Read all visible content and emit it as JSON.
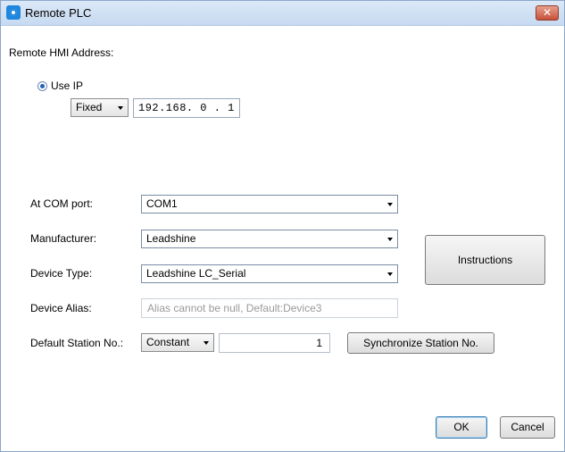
{
  "window": {
    "title": "Remote PLC",
    "close_glyph": "✕"
  },
  "remote_hmi": {
    "heading": "Remote HMI Address:",
    "use_ip_label": "Use IP",
    "ip_mode": "Fixed",
    "ip_address": "192.168. 0 . 1"
  },
  "com_port": {
    "label": "At COM port:",
    "value": "COM1"
  },
  "manufacturer": {
    "label": "Manufacturer:",
    "value": "Leadshine"
  },
  "device_type": {
    "label": "Device Type:",
    "value": "Leadshine LC_Serial"
  },
  "device_alias": {
    "label": "Device Alias:",
    "placeholder": "Alias cannot be null, Default:Device3"
  },
  "station": {
    "label": "Default Station No.:",
    "mode": "Constant",
    "value": "1",
    "sync_button": "Synchronize Station No."
  },
  "instructions_button": "Instructions",
  "footer": {
    "ok": "OK",
    "cancel": "Cancel"
  },
  "icons": {
    "app": "app-icon",
    "close": "close-icon",
    "dropdown": "chevron-down-icon",
    "radio": "radio-selected-icon"
  },
  "colors": {
    "titlebar": "#c7daf1",
    "close_button": "#c75039",
    "accent": "#3c7fb1"
  }
}
